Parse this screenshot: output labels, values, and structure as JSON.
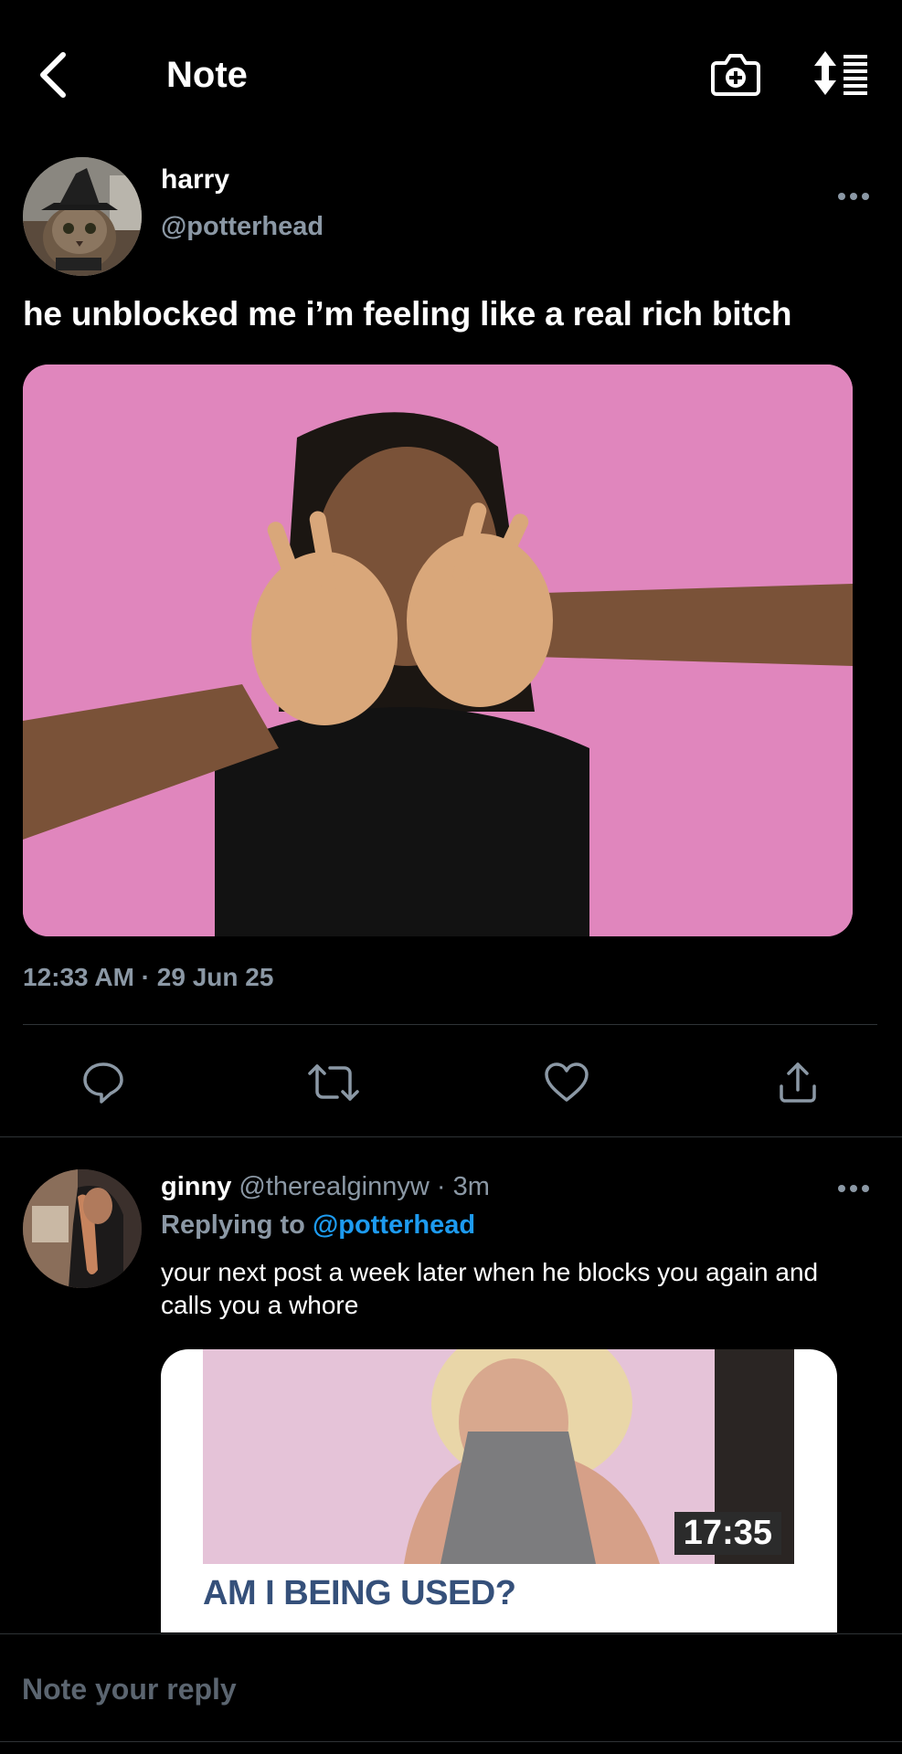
{
  "header": {
    "title": "Note",
    "icons": [
      "back-chevron-icon",
      "camera-plus-icon",
      "sort-icon"
    ]
  },
  "post": {
    "author_name": "harry",
    "author_handle": "@potterhead",
    "text": "he unblocked me i’m feeling like a real rich bitch",
    "timestamp": "12:33 AM · 29 Jun 25",
    "media_background": "#e086bd",
    "actions": [
      "reply-icon",
      "retweet-icon",
      "like-icon",
      "share-icon"
    ]
  },
  "reply": {
    "author_name": "ginny",
    "author_handle": "@therealginnyw",
    "time": "· 3m",
    "replying_to_label": "Replying to",
    "replying_to_handle": "@potterhead",
    "text": "your next post a week later when he blocks you again and calls you a whore",
    "card": {
      "duration": "17:35",
      "title": "AM I BEING USED?"
    }
  },
  "reply_bar": {
    "placeholder": "Note your reply"
  },
  "colors": {
    "background": "#000000",
    "muted": "#8b98a5",
    "link": "#1d9bf0",
    "divider": "#2f3336"
  }
}
